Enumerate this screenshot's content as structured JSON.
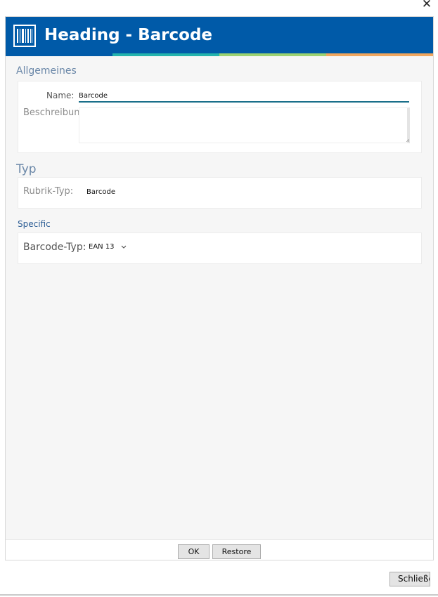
{
  "window": {
    "close_glyph": "✕"
  },
  "dialog": {
    "title": "Heading - Barcode",
    "icon": "barcode-icon",
    "accent_colors": [
      "#005aa8",
      "#23b3ad",
      "#9bd272",
      "#f0a65e"
    ]
  },
  "general": {
    "section_title": "Allgemeines",
    "name_label": "Name:",
    "name_value": "Barcode",
    "description_label": "Beschreibung:",
    "description_value": ""
  },
  "type": {
    "section_title": "Typ",
    "rubric_type_label": "Rubrik-Typ:",
    "rubric_type_value": "Barcode"
  },
  "specific": {
    "section_title": "Specific",
    "barcode_type_label": "Barcode-Typ:",
    "barcode_type_value": "EAN 13"
  },
  "footer": {
    "ok_label": "OK",
    "restore_label": "Restore"
  },
  "outer": {
    "close_label": "Schließen"
  }
}
